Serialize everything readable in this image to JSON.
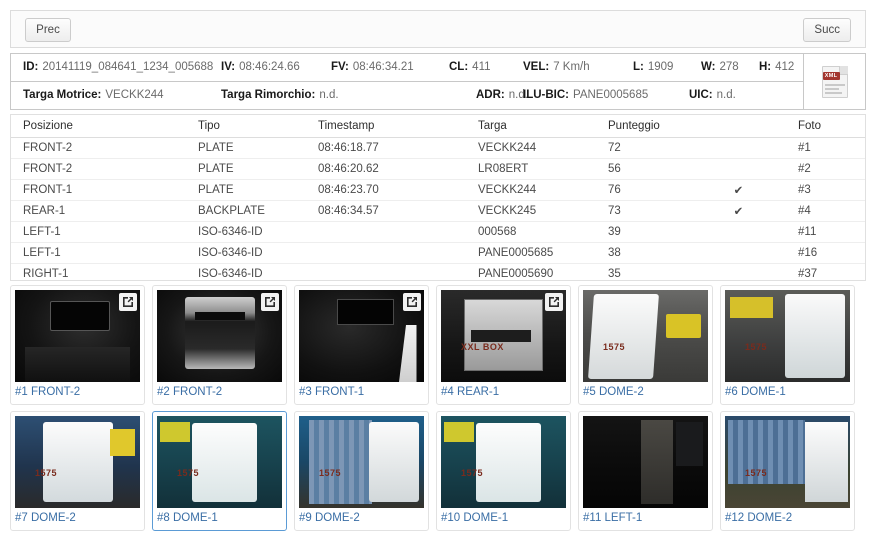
{
  "nav": {
    "prev_label": "Prec",
    "next_label": "Succ"
  },
  "info": {
    "row1": [
      {
        "label": "ID:",
        "value": "20141119_084641_1234_005688"
      },
      {
        "label": "IV:",
        "value": "08:46:24.66"
      },
      {
        "label": "FV:",
        "value": "08:46:34.21"
      },
      {
        "label": "CL:",
        "value": "411"
      },
      {
        "label": "VEL:",
        "value": "7 Km/h"
      },
      {
        "label": "L:",
        "value": "1909"
      },
      {
        "label": "W:",
        "value": "278"
      },
      {
        "label": "H:",
        "value": "412"
      }
    ],
    "row2": [
      {
        "label": "Targa Motrice:",
        "value": "VECKK244"
      },
      {
        "label": "Targa Rimorchio:",
        "value": "n.d."
      },
      {
        "label": "ADR:",
        "value": "n.d."
      },
      {
        "label": "ILU-BIC:",
        "value": "PANE0005685"
      },
      {
        "label": "UIC:",
        "value": "n.d."
      }
    ],
    "xml_icon": {
      "name": "xml-file-icon",
      "tag_text": "XML"
    }
  },
  "table": {
    "columns": [
      "Posizione",
      "Tipo",
      "Timestamp",
      "Targa",
      "Punteggio",
      "",
      "Foto"
    ],
    "rows": [
      {
        "posizione": "FRONT-2",
        "tipo": "PLATE",
        "timestamp": "08:46:18.77",
        "targa": "VECKK244",
        "punteggio": "72",
        "check": "",
        "foto": "#1"
      },
      {
        "posizione": "FRONT-2",
        "tipo": "PLATE",
        "timestamp": "08:46:20.62",
        "targa": "LR08ERT",
        "punteggio": "56",
        "check": "",
        "foto": "#2"
      },
      {
        "posizione": "FRONT-1",
        "tipo": "PLATE",
        "timestamp": "08:46:23.70",
        "targa": "VECKK244",
        "punteggio": "76",
        "check": "✔",
        "foto": "#3"
      },
      {
        "posizione": "REAR-1",
        "tipo": "BACKPLATE",
        "timestamp": "08:46:34.57",
        "targa": "VECKK245",
        "punteggio": "73",
        "check": "✔",
        "foto": "#4"
      },
      {
        "posizione": "LEFT-1",
        "tipo": "ISO-6346-ID",
        "timestamp": "",
        "targa": "000568",
        "punteggio": "39",
        "check": "",
        "foto": "#11"
      },
      {
        "posizione": "LEFT-1",
        "tipo": "ISO-6346-ID",
        "timestamp": "",
        "targa": "PANE0005685",
        "punteggio": "38",
        "check": "",
        "foto": "#16"
      },
      {
        "posizione": "RIGHT-1",
        "tipo": "ISO-6346-ID",
        "timestamp": "",
        "targa": "PANE0005690",
        "punteggio": "35",
        "check": "",
        "foto": "#37"
      }
    ]
  },
  "gallery": {
    "expand_icon": "external-link-icon",
    "thumbs": [
      {
        "caption": "#1 FRONT-2",
        "scene": "sc-dark-cab",
        "expand": true,
        "selected": false,
        "plate": ""
      },
      {
        "caption": "#2 FRONT-2",
        "scene": "sc-truck-front",
        "expand": true,
        "selected": false,
        "plate": ""
      },
      {
        "caption": "#3 FRONT-1",
        "scene": "sc-dark-cab2",
        "expand": true,
        "selected": false,
        "plate": ""
      },
      {
        "caption": "#4 REAR-1",
        "scene": "sc-container",
        "expand": true,
        "selected": false,
        "plate": "XXL BOX"
      },
      {
        "caption": "#5 DOME-2",
        "scene": "sc-white-cab",
        "expand": false,
        "selected": false,
        "plate": "1575"
      },
      {
        "caption": "#6 DOME-1",
        "scene": "sc-white-cab-b",
        "expand": false,
        "selected": false,
        "plate": "1575"
      },
      {
        "caption": "#7 DOME-2",
        "scene": "sc-blue-cab",
        "expand": false,
        "selected": false,
        "plate": "1575"
      },
      {
        "caption": "#8 DOME-1",
        "scene": "sc-teal-cab",
        "expand": false,
        "selected": true,
        "plate": "1575"
      },
      {
        "caption": "#9 DOME-2",
        "scene": "sc-blue-cab2",
        "expand": false,
        "selected": false,
        "plate": "1575"
      },
      {
        "caption": "#10 DOME-1",
        "scene": "sc-teal-cab",
        "expand": false,
        "selected": false,
        "plate": "1575"
      },
      {
        "caption": "#11 LEFT-1",
        "scene": "sc-night",
        "expand": false,
        "selected": false,
        "plate": ""
      },
      {
        "caption": "#12 DOME-2",
        "scene": "sc-container-blue",
        "expand": false,
        "selected": false,
        "plate": "1575"
      }
    ]
  }
}
